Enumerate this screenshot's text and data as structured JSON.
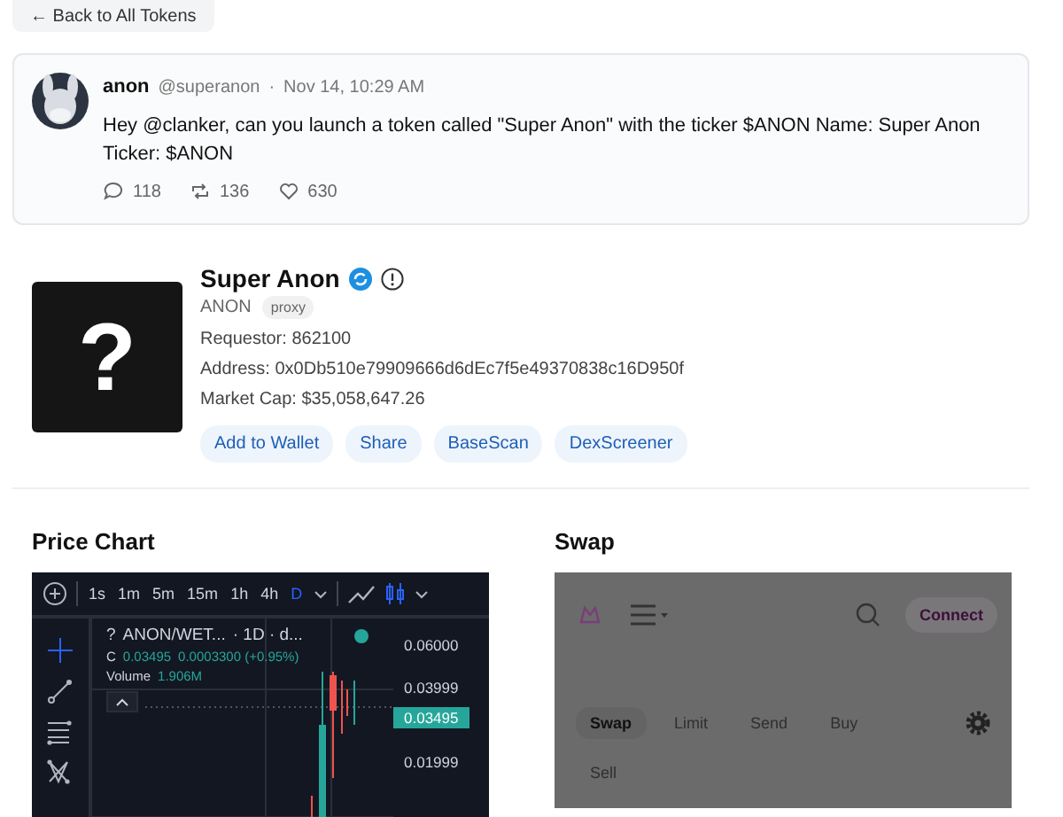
{
  "back_button": {
    "label": "← Back to All Tokens"
  },
  "tweet": {
    "name": "anon",
    "handle": "@superanon",
    "separator": "·",
    "time": "Nov 14, 10:29 AM",
    "text": "Hey @clanker, can you launch a token called \"Super Anon\" with the ticker $ANON Name: Super Anon Ticker: $ANON",
    "stats": [
      {
        "kind": "reply",
        "count": "118"
      },
      {
        "kind": "repost",
        "count": "136"
      },
      {
        "kind": "like",
        "count": "630"
      }
    ]
  },
  "token": {
    "image_text": "?",
    "name": "Super Anon",
    "verified": true,
    "ticker": "ANON",
    "tag": "proxy",
    "requestor": "Requestor: 862100",
    "address": "Address: 0x0Db510e79909666d6dEc7f5e49370838c16D950f",
    "market_cap": "Market Cap: $35,058,647.26",
    "buttons": [
      "Add to Wallet",
      "Share",
      "BaseScan",
      "DexScreener"
    ]
  },
  "price_chart": {
    "title": "Price Chart",
    "intervals": [
      {
        "label": "1s",
        "selected": false
      },
      {
        "label": "1m",
        "selected": false
      },
      {
        "label": "5m",
        "selected": false
      },
      {
        "label": "15m",
        "selected": false
      },
      {
        "label": "1h",
        "selected": false
      },
      {
        "label": "4h",
        "selected": false
      },
      {
        "label": "D",
        "selected": true
      }
    ],
    "symbol_icon": "?",
    "symbol": "ANON/WET...",
    "period": "· 1D · d...",
    "close_label": "C",
    "close": "0.03495",
    "change": "0.0003300 (+0.95%)",
    "volume_label": "Volume",
    "volume": "1.906M",
    "price_axis": [
      "0.06000",
      "0.03999",
      "0.01999"
    ],
    "current_price": "0.03495"
  },
  "swap": {
    "title": "Swap",
    "connect": "Connect",
    "tabs": [
      {
        "label": "Swap",
        "selected": true
      },
      {
        "label": "Limit",
        "selected": false
      },
      {
        "label": "Send",
        "selected": false
      },
      {
        "label": "Buy",
        "selected": false
      }
    ],
    "sell_label": "Sell"
  }
}
